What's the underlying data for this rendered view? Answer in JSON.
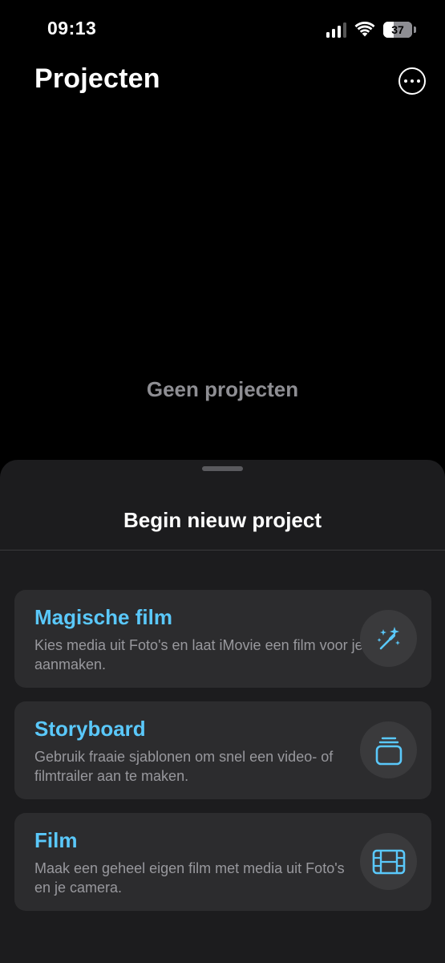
{
  "status_bar": {
    "time": "09:13",
    "battery_level": "37",
    "battery_percent": 37,
    "signal_bars_active": 3,
    "signal_bars_total": 4
  },
  "header": {
    "title": "Projecten",
    "more_icon": "ellipsis-circle-icon"
  },
  "main": {
    "empty_text": "Geen projecten"
  },
  "sheet": {
    "title": "Begin nieuw project",
    "options": [
      {
        "title": "Magische film",
        "description": "Kies media uit Foto's en laat iMovie een film voor je aanmaken.",
        "icon": "magic-wand-icon"
      },
      {
        "title": "Storyboard",
        "description": "Gebruik fraaie sjablonen om snel een video- of filmtrailer aan te maken.",
        "icon": "storyboard-stack-icon"
      },
      {
        "title": "Film",
        "description": "Maak een geheel eigen film met media uit Foto's en je camera.",
        "icon": "film-strip-icon"
      }
    ]
  },
  "colors": {
    "accent": "#5ac8fa",
    "background": "#000000",
    "sheet": "#1c1c1e",
    "card": "#2c2c2e",
    "secondary_text": "#98989d"
  }
}
